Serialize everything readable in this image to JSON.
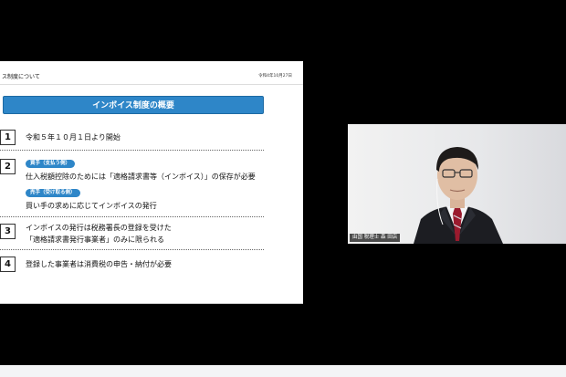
{
  "slide": {
    "title": "ス制度について",
    "date": "令和4年10月27日",
    "overview_label": "インボイス制度の概要",
    "items": [
      {
        "num": "1",
        "text": "令和５年１０月１日より開始"
      },
      {
        "num": "2",
        "buyer_tag": "買手（支払う側）",
        "buyer_text": "仕入税額控除のためには「適格請求書等（インボイス）」の保存が必要",
        "seller_tag": "売手（受け取る側）",
        "seller_text": "買い手の求めに応じてインボイスの発行"
      },
      {
        "num": "3",
        "line1": "インボイスの発行は税務署長の登録を受けた",
        "line2": "「適格請求書発行事業者」のみに限られる"
      },
      {
        "num": "4",
        "text": "登録した事業者は消費税の申告・納付が必要"
      }
    ]
  },
  "video": {
    "name": "由国 税理士 森 田店"
  },
  "colors": {
    "accent": "#2e86c8",
    "background": "#000000"
  }
}
